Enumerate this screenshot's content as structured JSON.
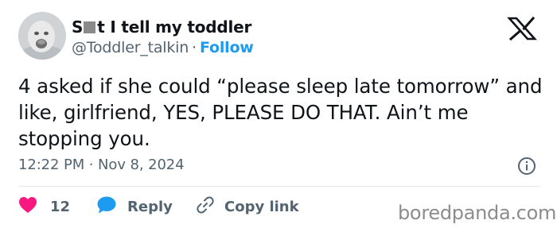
{
  "author": {
    "name_prefix": "S",
    "name_suffix": "t I tell my toddler",
    "handle": "@Toddler_talkin",
    "separator": "·",
    "follow_label": "Follow"
  },
  "tweet": {
    "text": "4 asked if she could “please sleep late tomorrow” and like, girlfriend, YES, PLEASE DO THAT. Ain’t me stopping you.",
    "timestamp": "12:22 PM · Nov 8, 2024"
  },
  "actions": {
    "like_count": "12",
    "reply_label": "Reply",
    "copy_label": "Copy link"
  },
  "watermark": "boredpanda.com",
  "colors": {
    "accent": "#1d9bf0",
    "like": "#f91880",
    "secondary_text": "#536471",
    "primary_text": "#0f1419"
  },
  "icons": [
    "avatar",
    "x-logo-icon",
    "info-icon",
    "heart-icon",
    "reply-bubble-icon",
    "link-icon"
  ]
}
